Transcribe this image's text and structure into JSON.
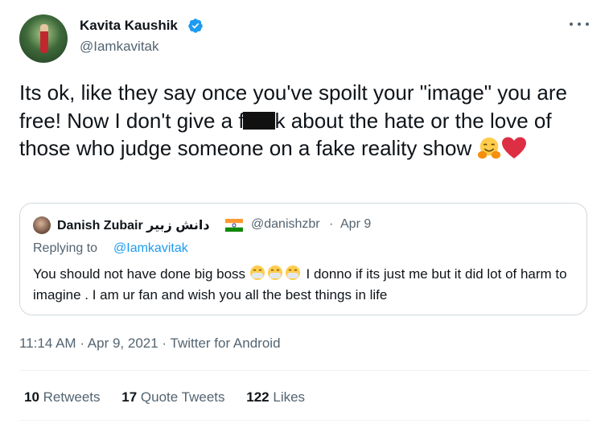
{
  "author": {
    "display_name": "Kavita Kaushik",
    "handle": "@Iamkavitak",
    "verified": true
  },
  "tweet": {
    "text_before_redaction": "Its ok, like they say once you've spoilt your \"image\" you are free! Now I don't give a f",
    "text_after_redaction": "k about the hate or the love of those who judge someone on a fake reality show",
    "emojis": [
      "hugging-face",
      "red-heart"
    ]
  },
  "quoted_tweet": {
    "display_name": "Danish Zubair دانش زبیر",
    "flag": "india-flag",
    "handle": "@danishzbr",
    "separator": "·",
    "date": "Apr 9",
    "replying_label": "Replying to",
    "replying_handle": "@Iamkavitak",
    "text_start": "You should not have done big boss",
    "text_end": "I donno if its just me but it did lot of harm to imagine . I am ur fan and wish you all the best things in life"
  },
  "meta": {
    "time": "11:14 AM",
    "date": "Apr 9, 2021",
    "source": "Twitter for Android",
    "separator": "·"
  },
  "stats": {
    "retweets_count": "10",
    "retweets_label": "Retweets",
    "quotes_count": "17",
    "quotes_label": "Quote Tweets",
    "likes_count": "122",
    "likes_label": "Likes"
  },
  "colors": {
    "accent": "#1d9bf0",
    "secondary_text": "#536471",
    "border": "#cfd9de"
  }
}
